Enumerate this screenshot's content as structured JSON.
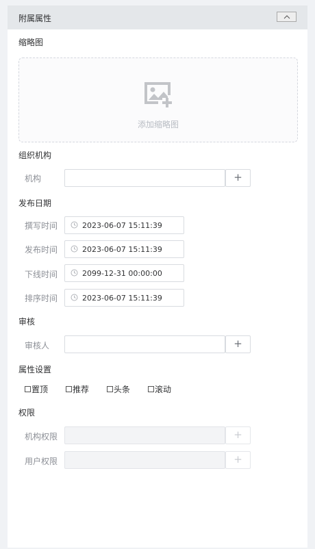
{
  "panel": {
    "title": "附属属性",
    "collapse_icon": "chevron-up-icon"
  },
  "thumbnail": {
    "label": "缩略图",
    "add_text": "添加缩略图",
    "icon": "add-image-icon"
  },
  "organization": {
    "section": "组织机构",
    "field_label": "机构",
    "value": "",
    "add_button": "+"
  },
  "publish_dates": {
    "section": "发布日期",
    "fields": [
      {
        "label": "撰写时间",
        "value": "2023-06-07 15:11:39"
      },
      {
        "label": "发布时间",
        "value": "2023-06-07 15:11:39"
      },
      {
        "label": "下线时间",
        "value": "2099-12-31 00:00:00"
      },
      {
        "label": "排序时间",
        "value": "2023-06-07 15:11:39"
      }
    ]
  },
  "review": {
    "section": "审核",
    "field_label": "审核人",
    "value": "",
    "add_button": "+"
  },
  "attributes": {
    "section": "属性设置",
    "options": [
      {
        "label": "置顶",
        "checked": false
      },
      {
        "label": "推荐",
        "checked": false
      },
      {
        "label": "头条",
        "checked": false
      },
      {
        "label": "滚动",
        "checked": false
      }
    ]
  },
  "permissions": {
    "section": "权限",
    "fields": [
      {
        "label": "机构权限",
        "value": "",
        "add_button": "+"
      },
      {
        "label": "用户权限",
        "value": "",
        "add_button": "+"
      }
    ]
  }
}
